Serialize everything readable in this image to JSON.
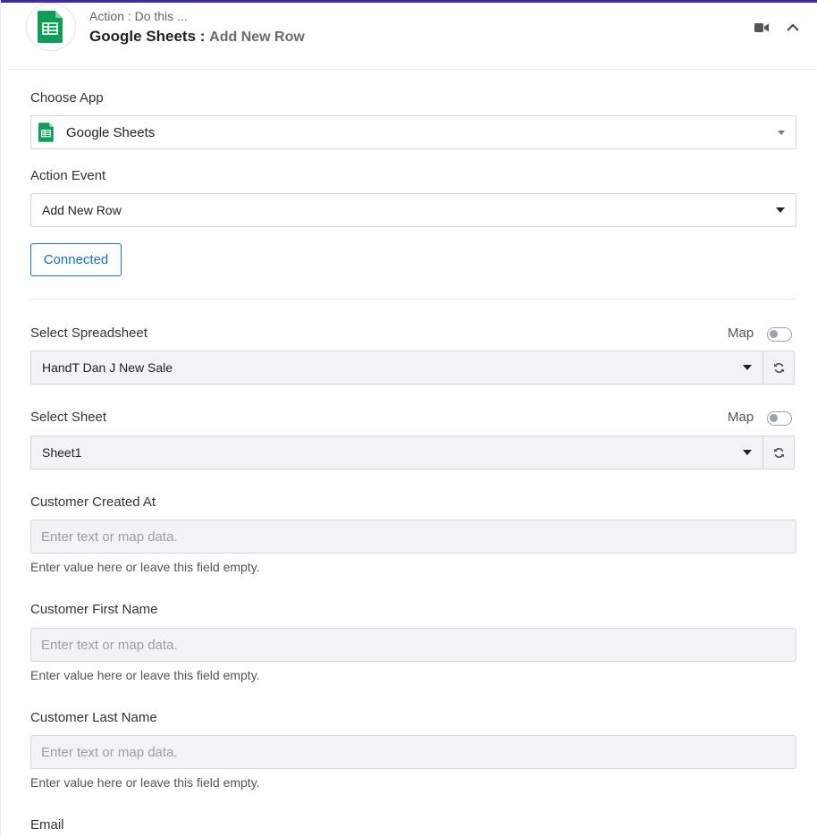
{
  "header": {
    "subtitle": "Action : Do this ...",
    "app_name": "Google Sheets :",
    "action_name": "Add New Row"
  },
  "choose_app": {
    "label": "Choose App",
    "value": "Google Sheets"
  },
  "action_event": {
    "label": "Action Event",
    "value": "Add New Row"
  },
  "connection": {
    "button_label": "Connected"
  },
  "spreadsheet": {
    "label": "Select Spreadsheet",
    "map_label": "Map",
    "value": "HandT Dan J New Sale"
  },
  "sheet": {
    "label": "Select Sheet",
    "map_label": "Map",
    "value": "Sheet1"
  },
  "fields": [
    {
      "label": "Customer Created At",
      "placeholder": "Enter text or map data.",
      "hint": "Enter value here or leave this field empty."
    },
    {
      "label": "Customer First Name",
      "placeholder": "Enter text or map data.",
      "hint": "Enter value here or leave this field empty."
    },
    {
      "label": "Customer Last Name",
      "placeholder": "Enter text or map data.",
      "hint": "Enter value here or leave this field empty."
    },
    {
      "label": "Email"
    }
  ],
  "colors": {
    "accent": "#3f2a9e",
    "connected": "#1a73b8",
    "sheets_green": "#0f9d58"
  },
  "icons": [
    "google-sheets-icon",
    "video-camera-icon",
    "chevron-up-icon",
    "refresh-icon",
    "caret-down-icon"
  ]
}
